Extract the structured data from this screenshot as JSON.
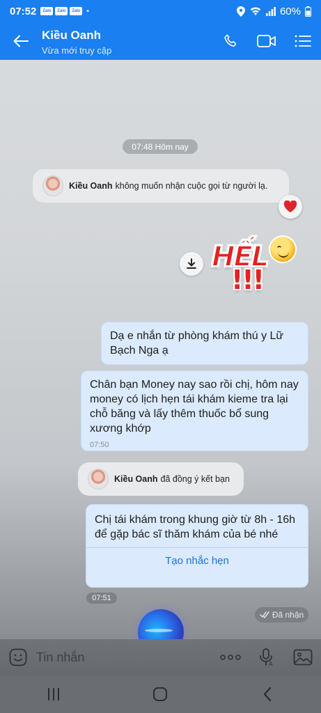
{
  "status_bar": {
    "time": "07:52",
    "app_icons": [
      "Zalo",
      "Zalo",
      "Zalo"
    ],
    "dot": "•",
    "battery": "60%"
  },
  "header": {
    "name": "Kiều Oanh",
    "subtitle": "Vừa mới truy cập",
    "color": "#1a7ff0"
  },
  "chat": {
    "time_divider": "07:48 Hôm nay",
    "system_1": {
      "name": "Kiều Oanh",
      "text": "không muốn nhận cuộc gọi từ người lạ."
    },
    "sticker": {
      "word": "HẾL",
      "bangs": "!!!"
    },
    "msg_1": {
      "text": "Dạ e nhắn từ phòng khám thú y Lữ Bạch Nga ạ"
    },
    "msg_2": {
      "text": "Chân bạn Money nay sao rồi chị, hôm nay money có lịch hẹn tái khám kieme tra lại chỗ băng và lấy thêm thuốc bổ sung xương khớp",
      "time": "07:50"
    },
    "system_2": {
      "name": "Kiều Oanh",
      "text": "đã đồng ý kết bạn"
    },
    "msg_3": {
      "text": "Chị tái khám trong khung giờ từ 8h - 16h để gặp bác sĩ thăm khám của bé nhé",
      "action": "Tạo nhắc hẹn"
    },
    "time_chip": "07:51",
    "seen_label": "Đã nhận"
  },
  "input": {
    "placeholder": "Tin nhắn"
  }
}
